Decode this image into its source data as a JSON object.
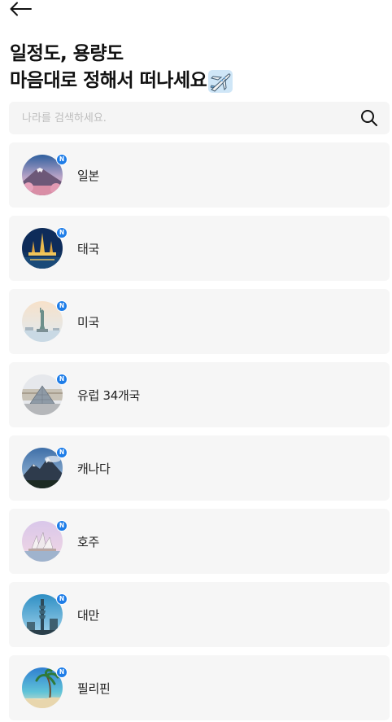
{
  "header": {
    "title_line1": "일정도, 용량도",
    "title_line2": "마음대로 정해서 떠나세요"
  },
  "search": {
    "placeholder": "나라를 검색하세요.",
    "value": ""
  },
  "badge_label": "N",
  "colors": {
    "badge": "#1e7de8",
    "card_bg": "#f6f6f6",
    "search_bg": "#f5f5f5"
  },
  "countries": [
    {
      "label": "일본",
      "image": "mountain-fuji-thumbnail"
    },
    {
      "label": "태국",
      "image": "temple-night-thumbnail"
    },
    {
      "label": "미국",
      "image": "statue-of-liberty-thumbnail"
    },
    {
      "label": "유럽 34개국",
      "image": "louvre-pyramid-thumbnail"
    },
    {
      "label": "캐나다",
      "image": "rocky-mountain-thumbnail"
    },
    {
      "label": "호주",
      "image": "opera-house-thumbnail"
    },
    {
      "label": "대만",
      "image": "taipei-101-thumbnail"
    },
    {
      "label": "필리핀",
      "image": "tropical-beach-thumbnail"
    }
  ]
}
